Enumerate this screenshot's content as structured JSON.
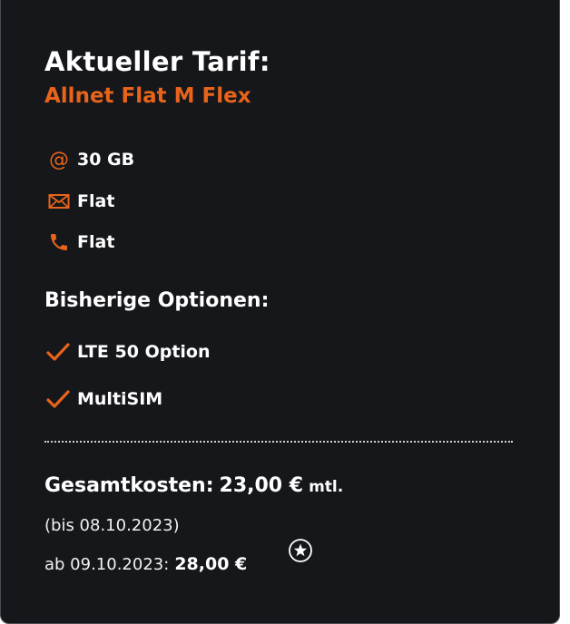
{
  "card": {
    "title": "Aktueller Tarif:",
    "tariff_name": "Allnet Flat M Flex",
    "features": [
      {
        "icon": "at-icon",
        "label": "30 GB"
      },
      {
        "icon": "envelope-icon",
        "label": "Flat"
      },
      {
        "icon": "phone-icon",
        "label": "Flat"
      }
    ],
    "options_title": "Bisherige Optionen:",
    "options": [
      {
        "icon": "check-icon",
        "label": "LTE 50 Option"
      },
      {
        "icon": "check-icon",
        "label": "MultiSIM"
      }
    ],
    "total": {
      "label": "Gesamtkosten:",
      "amount": "23,00 €",
      "period": "mtl.",
      "until": "(bis 08.10.2023)",
      "from_label": "ab 09.10.2023:",
      "from_price": "28,00 €",
      "footnote_icon": "star-circle-icon"
    }
  },
  "colors": {
    "background": "#15171a",
    "accent": "#e8631b",
    "text": "#ffffff"
  }
}
